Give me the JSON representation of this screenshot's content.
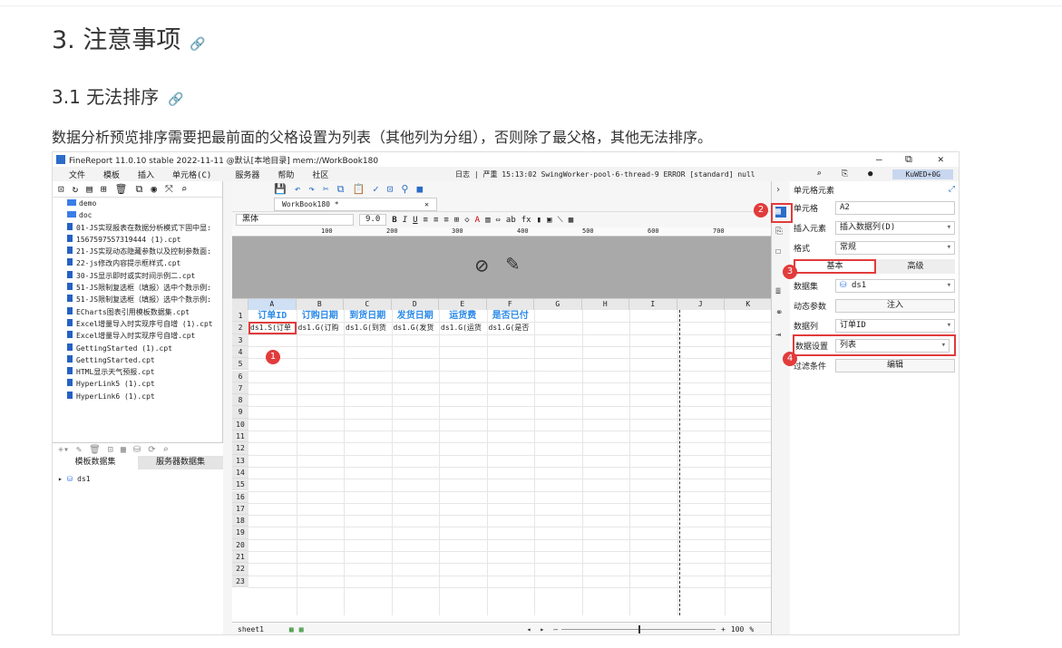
{
  "heading3": "3. 注意事项",
  "heading4": "3.1 无法排序",
  "anchor": "🔗",
  "paragraph": "数据分析预览排序需要把最前面的父格设置为列表（其他列为分组），否则除了最父格，其他无法排序。",
  "app": {
    "title": "FineReport 11.0.10 stable 2022-11-11 @默认[本地目录]    mem://WorkBook180",
    "menu": [
      "文件",
      "模板",
      "插入",
      "单元格(C)",
      "服务器",
      "帮助",
      "社区"
    ],
    "log": "日志 | 严重 15:13:02 SwingWorker-pool-6-thread-9 ERROR [standard] null",
    "user": "KuWED+0G"
  },
  "tree": [
    {
      "t": "fd",
      "n": "demo"
    },
    {
      "t": "fd",
      "n": "doc"
    },
    {
      "t": "fl",
      "n": "01-JS实现报表在数据分析模式下固中显:"
    },
    {
      "t": "fl",
      "n": "1567597557319444 (1).cpt"
    },
    {
      "t": "fl",
      "n": "21-JS实现动态隐藏参数以及控制参数面:"
    },
    {
      "t": "fl",
      "n": "22-js修改内容提示框样式.cpt"
    },
    {
      "t": "fl",
      "n": "30-JS显示即时或实时间示例二.cpt"
    },
    {
      "t": "fl",
      "n": "51-JS限制复选框（填报）选中个数示例:"
    },
    {
      "t": "fl",
      "n": "51-JS限制复选框（填报）选中个数示例:"
    },
    {
      "t": "fl",
      "n": "ECharts图表引用模板数据集.cpt"
    },
    {
      "t": "fl",
      "n": "Excel增量导入时实现序号自增 (1).cpt"
    },
    {
      "t": "fl",
      "n": "Excel增量导入时实现序号自增.cpt"
    },
    {
      "t": "fl",
      "n": "GettingStarted (1).cpt"
    },
    {
      "t": "fl",
      "n": "GettingStarted.cpt"
    },
    {
      "t": "fl",
      "n": "HTML显示天气预报.cpt"
    },
    {
      "t": "fl",
      "n": "HyperLink5 (1).cpt"
    },
    {
      "t": "fl",
      "n": "HyperLink6 (1).cpt"
    }
  ],
  "dsTabs": [
    "模板数据集",
    "服务器数据集"
  ],
  "dataset": "ds1",
  "workbookTab": "WorkBook180 *",
  "sheet": "sheet1",
  "zoom": "100",
  "font": "黑体",
  "fontSize": "9.0",
  "ruler": [
    "100",
    "200",
    "300",
    "400",
    "500",
    "600",
    "700"
  ],
  "cols": [
    "A",
    "B",
    "C",
    "D",
    "E",
    "F",
    "G",
    "H",
    "I",
    "J",
    "K"
  ],
  "row1": [
    "订单ID",
    "订购日期",
    "到货日期",
    "发货日期",
    "运货费",
    "是否已付"
  ],
  "row2": [
    "ds1.S(订单",
    "ds1.G(订购",
    "ds1.G(到货",
    "ds1.G(发货",
    "ds1.G(运货",
    "ds1.G(是否"
  ],
  "rows": [
    "1",
    "2",
    "3",
    "4",
    "5",
    "6",
    "7",
    "8",
    "9",
    "10",
    "11",
    "12",
    "13",
    "14",
    "15",
    "16",
    "17",
    "18",
    "19",
    "20",
    "21",
    "22",
    "23"
  ],
  "panel": {
    "title": "单元格元素",
    "cellLabel": "单元格",
    "cell": "A2",
    "insertLabel": "插入元素",
    "insert": "插入数据列(D)",
    "formatLabel": "格式",
    "format": "常规",
    "tabBasic": "基本",
    "tabAdv": "高级",
    "dsLabel": "数据集",
    "ds": "ds1",
    "dynLabel": "动态参数",
    "inject": "注入",
    "colLabel": "数据列",
    "col": "订单ID",
    "setLabel": "数据设置",
    "set": "列表",
    "filterLabel": "过滤条件",
    "edit": "编辑"
  },
  "badges": [
    "1",
    "2",
    "3",
    "4"
  ]
}
